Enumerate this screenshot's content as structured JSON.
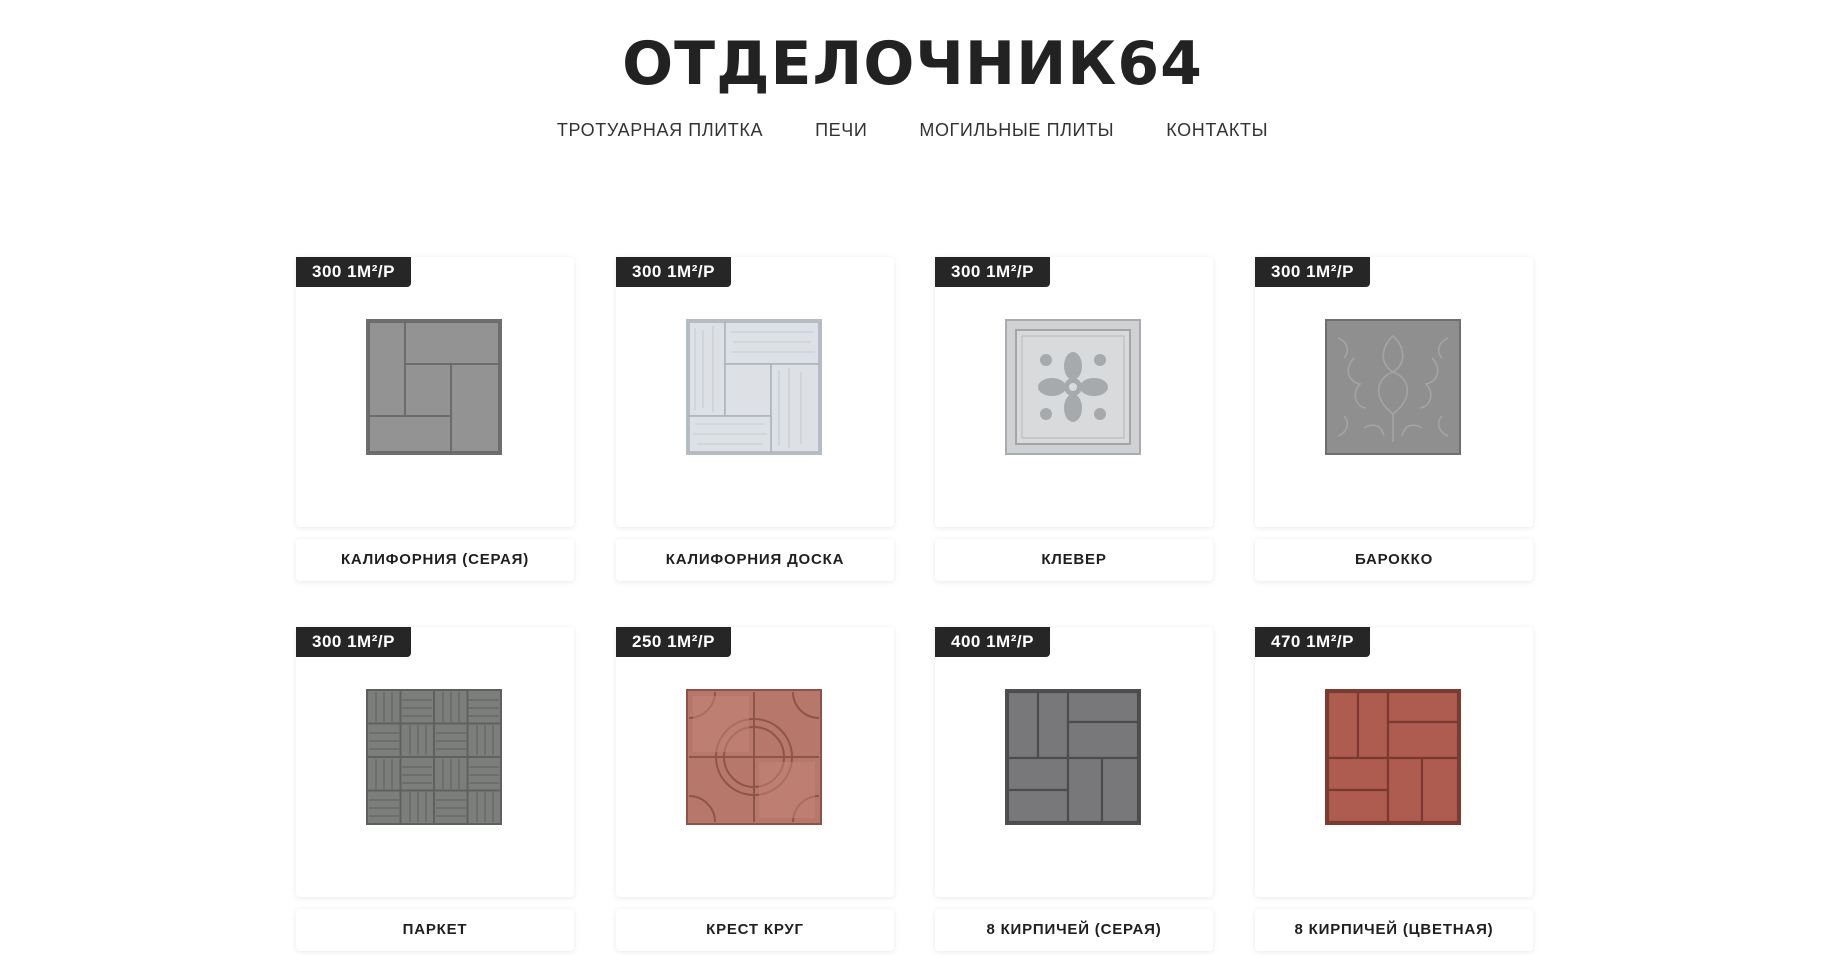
{
  "site": {
    "logo": "ОТДЕЛОЧНИК64"
  },
  "nav": {
    "items": [
      {
        "label": "ТРОТУАРНАЯ ПЛИТКА"
      },
      {
        "label": "ПЕЧИ"
      },
      {
        "label": "МОГИЛЬНЫЕ ПЛИТЫ"
      },
      {
        "label": "КОНТАКТЫ"
      }
    ]
  },
  "products": [
    {
      "price": "300 1М²/Р",
      "name": "КАЛИФОРНИЯ (СЕРАЯ)",
      "icon": "california-gray-tile-icon",
      "color": "#8e8e8e"
    },
    {
      "price": "300 1М²/Р",
      "name": "КАЛИФОРНИЯ ДОСКА",
      "icon": "california-board-tile-icon",
      "color": "#d3d8dc"
    },
    {
      "price": "300 1М²/Р",
      "name": "КЛЕВЕР",
      "icon": "clover-tile-icon",
      "color": "#cfd1d3"
    },
    {
      "price": "300 1М²/Р",
      "name": "БАРОККО",
      "icon": "baroque-tile-icon",
      "color": "#8f8f8f"
    },
    {
      "price": "300 1М²/Р",
      "name": "ПАРКЕТ",
      "icon": "parquet-tile-icon",
      "color": "#7c7e7c"
    },
    {
      "price": "250 1М²/Р",
      "name": "КРЕСТ КРУГ",
      "icon": "cross-circle-tile-icon",
      "color": "#b8776b"
    },
    {
      "price": "400 1М²/Р",
      "name": "8 КИРПИЧЕЙ (СЕРАЯ)",
      "icon": "eight-bricks-gray-tile-icon",
      "color": "#747476"
    },
    {
      "price": "470 1М²/Р",
      "name": "8 КИРПИЧЕЙ (ЦВЕТНАЯ)",
      "icon": "eight-bricks-colored-tile-icon",
      "color": "#a9584b"
    }
  ]
}
